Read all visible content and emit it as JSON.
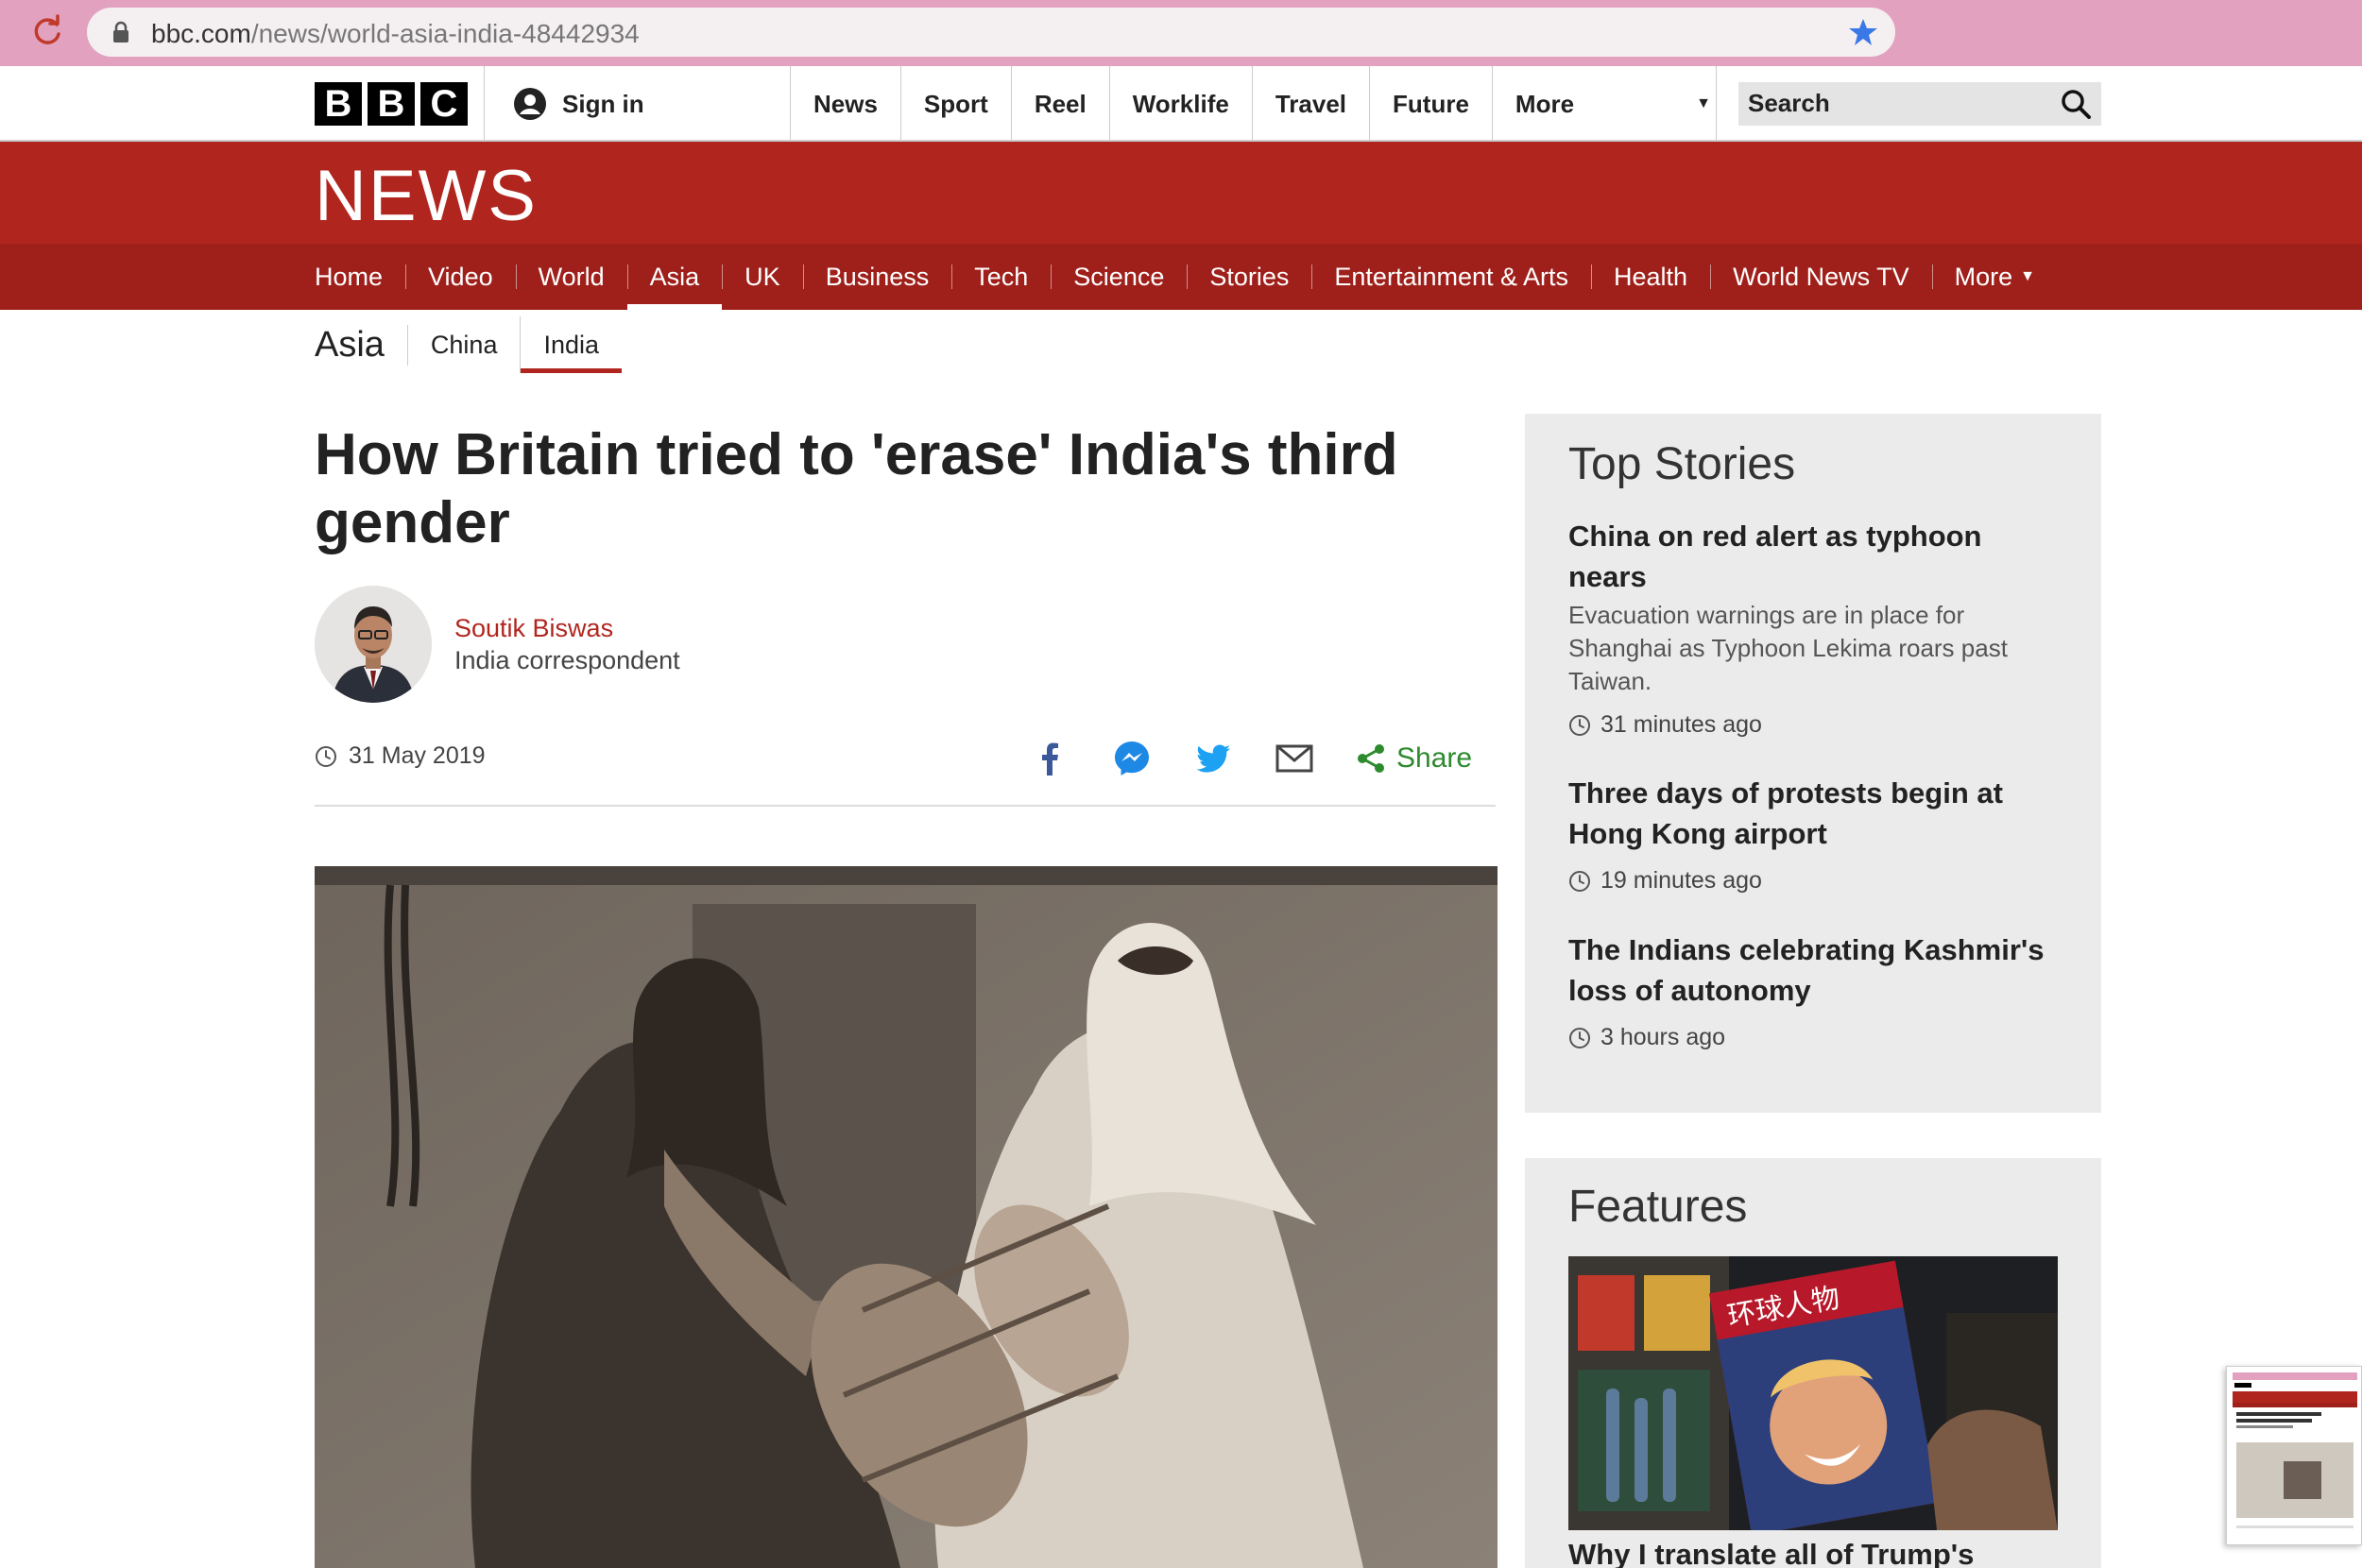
{
  "browser": {
    "url_domain": "bbc.com",
    "url_path": "/news/world-asia-india-48442934"
  },
  "masthead": {
    "logo_letters": [
      "B",
      "B",
      "C"
    ],
    "signin_label": "Sign in",
    "nav": [
      "News",
      "Sport",
      "Reel",
      "Worklife",
      "Travel",
      "Future"
    ],
    "more_label": "More",
    "search_placeholder": "Search"
  },
  "news_banner": {
    "title": "NEWS",
    "nav": [
      "Home",
      "Video",
      "World",
      "Asia",
      "UK",
      "Business",
      "Tech",
      "Science",
      "Stories",
      "Entertainment & Arts",
      "Health",
      "World News TV"
    ],
    "active": "Asia",
    "more_label": "More"
  },
  "subnav": {
    "title": "Asia",
    "items": [
      "China",
      "India"
    ],
    "active": "India"
  },
  "article": {
    "headline": "How Britain tried to 'erase' India's third gender",
    "author_name": "Soutik Biswas",
    "author_role": "India correspondent",
    "date": "31 May 2019",
    "share_label": "Share"
  },
  "top_stories": {
    "title": "Top Stories",
    "items": [
      {
        "headline": "China on red alert as typhoon nears",
        "summary": "Evacuation warnings are in place for Shanghai as Typhoon Lekima roars past Taiwan.",
        "time": "31 minutes ago"
      },
      {
        "headline": "Three days of protests begin at Hong Kong airport",
        "summary": "",
        "time": "19 minutes ago"
      },
      {
        "headline": "The Indians celebrating Kashmir's loss of autonomy",
        "summary": "",
        "time": "3 hours ago"
      }
    ]
  },
  "features": {
    "title": "Features",
    "headline": "Why I translate all of Trump's",
    "image_caption": "环球人物"
  },
  "colors": {
    "bbc_red": "#b0261f",
    "nav_red": "#9f201b",
    "share_green": "#2d8a2d",
    "chrome_pink": "#e2a2bf"
  }
}
